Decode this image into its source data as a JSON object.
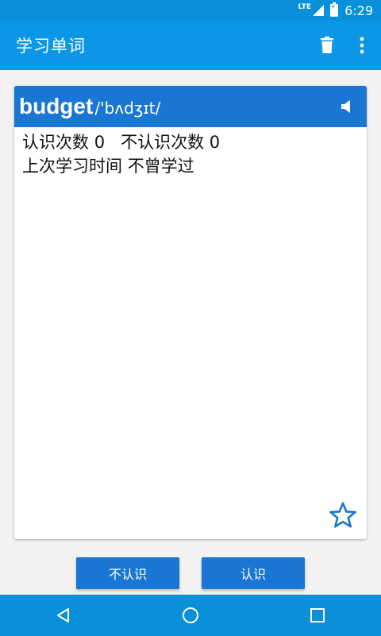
{
  "status": {
    "network": "LTE",
    "time": "6:29"
  },
  "appbar": {
    "title": "学习单词",
    "icons": [
      "trash-icon",
      "more-vert-icon"
    ]
  },
  "card": {
    "word": "budget",
    "phonetic": "/'bʌdʒɪt/",
    "known_label": "认识次数",
    "known_count": "0",
    "unknown_label": "不认识次数",
    "unknown_count": "0",
    "last_study_label": "上次学习时间",
    "last_study_value": "不曾学过",
    "icons": [
      "speaker-icon",
      "star-outline-icon"
    ]
  },
  "actions": {
    "unknown_label": "不认识",
    "known_label": "认识"
  },
  "nav": {
    "icons": [
      "back-icon",
      "home-icon",
      "recents-icon"
    ]
  },
  "colors": {
    "status_bar": "#0a8fd9",
    "app_bar": "#0c97e6",
    "accent": "#1976d2",
    "background": "#f2f2f2"
  }
}
